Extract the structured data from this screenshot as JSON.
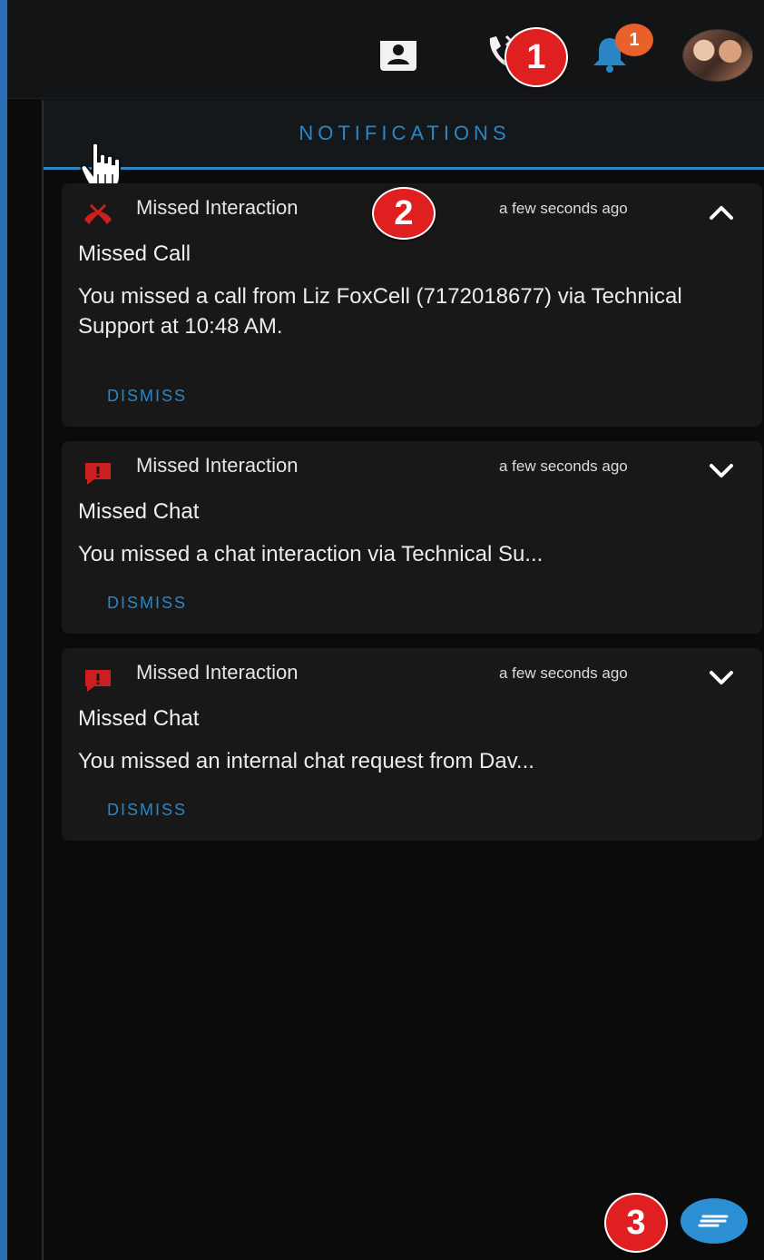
{
  "topbar": {
    "icons": {
      "contacts": "contacts-icon",
      "phone": "phone-icon",
      "notifications": "bell-icon"
    },
    "notification_count": "1",
    "colors": {
      "background": "#121416",
      "badge": "#e8602a",
      "bell": "#2b86c5"
    }
  },
  "callouts": [
    "1",
    "2",
    "3"
  ],
  "panel": {
    "title": "NOTIFICATIONS",
    "colors": {
      "accent": "#2b86c5",
      "card": "#181818",
      "missed": "#cc1f1f"
    }
  },
  "notifications": [
    {
      "type": "Missed Interaction",
      "icon": "missed-call-icon",
      "time": "a few seconds ago",
      "subject": "Missed Call",
      "body": "You missed a call from Liz FoxCell (7172018677) via Technical Support at 10:48 AM.",
      "dismiss": "DISMISS",
      "expanded": true
    },
    {
      "type": "Missed Interaction",
      "icon": "missed-chat-icon",
      "time": "a few seconds ago",
      "subject": "Missed Chat",
      "body": "You missed a chat interaction via Technical Su...",
      "dismiss": "DISMISS",
      "expanded": false
    },
    {
      "type": "Missed Interaction",
      "icon": "missed-chat-icon",
      "time": "a few seconds ago",
      "subject": "Missed Chat",
      "body": "You missed an internal chat request from Dav...",
      "dismiss": "DISMISS",
      "expanded": false
    }
  ],
  "fab": {
    "icon": "message-icon"
  }
}
